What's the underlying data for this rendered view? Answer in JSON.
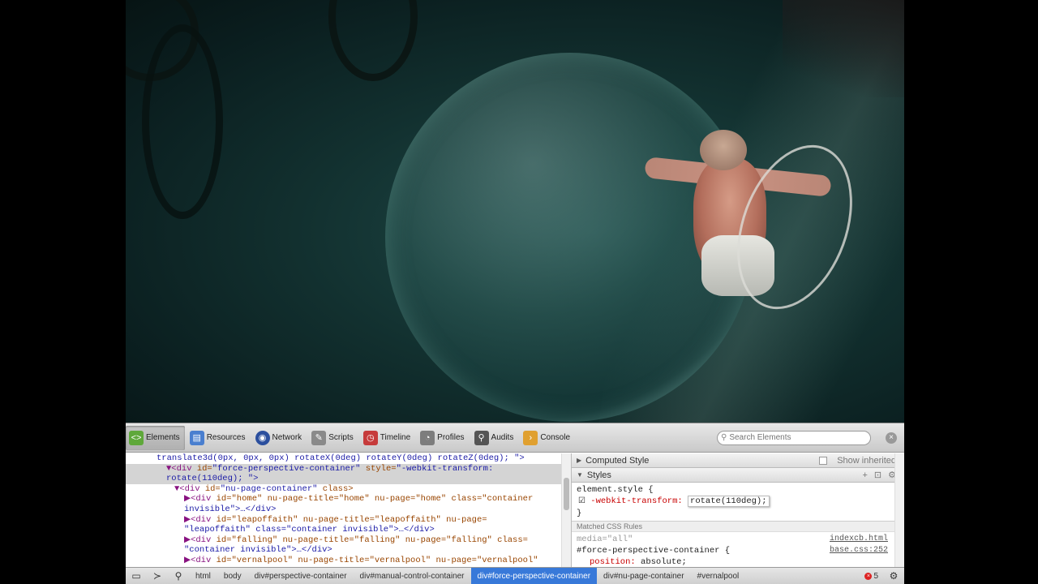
{
  "devtools": {
    "toolbar": {
      "tabs": [
        {
          "label": "Elements",
          "icon": "elements-icon",
          "active": true
        },
        {
          "label": "Resources",
          "icon": "resources-icon"
        },
        {
          "label": "Network",
          "icon": "network-icon"
        },
        {
          "label": "Scripts",
          "icon": "scripts-icon"
        },
        {
          "label": "Timeline",
          "icon": "timeline-icon"
        },
        {
          "label": "Profiles",
          "icon": "profiles-icon"
        },
        {
          "label": "Audits",
          "icon": "audits-icon"
        },
        {
          "label": "Console",
          "icon": "console-icon"
        }
      ],
      "search_placeholder": "Search Elements"
    },
    "dom": {
      "line0": "translate3d(0px, 0px, 0px) rotateX(0deg) rotateY(0deg) rotateZ(0deg); \">",
      "line1_tag": "▼<div ",
      "line1_attr": "id=",
      "line1_val": "\"force-perspective-container\"",
      "line1_attr2": " style=",
      "line1_val2": "\"-webkit-transform:",
      "line2": "rotate(110deg); \">",
      "line3_tag": "▼<div ",
      "line3_attr": "id=",
      "line3_val": "\"nu-page-container\"",
      "line3_attr2": " class>",
      "line4_tag": "▶<div ",
      "line4_rest": "id=\"home\" nu-page-title=\"home\" nu-page=\"home\" class=\"container",
      "line5": "invisible\">…</div>",
      "line6_tag": "▶<div ",
      "line6_rest": "id=\"leapoffaith\" nu-page-title=\"leapoffaith\" nu-page=",
      "line7": "\"leapoffaith\" class=\"container invisible\">…</div>",
      "line8_tag": "▶<div ",
      "line8_rest": "id=\"falling\" nu-page-title=\"falling\" nu-page=\"falling\" class=",
      "line9": "\"container invisible\">…</div>",
      "line10_tag": "▶<div ",
      "line10_rest": "id=\"vernalpool\" nu-page-title=\"vernalpool\" nu-page=\"vernalpool\""
    },
    "sidebar": {
      "computed_style": "Computed Style",
      "show_inherited": "Show inherited",
      "styles": "Styles",
      "element_style": "element.style {",
      "prop_name": "-webkit-transform:",
      "prop_value": "rotate(110deg);",
      "close_brace": "}",
      "matched_rules": "Matched CSS Rules",
      "media": "media=\"all\"",
      "media_link": "indexcb.html",
      "selector": "#force-perspective-container {",
      "selector_link": "base.css:252",
      "position_prop": "position:",
      "position_val": "absolute;"
    },
    "breadcrumbs": [
      "html",
      "body",
      "div#perspective-container",
      "div#manual-control-container",
      "div#force-perspective-container",
      "div#nu-page-container",
      "#vernalpool"
    ],
    "active_crumb": "div#force-perspective-container",
    "error_count": "5"
  }
}
